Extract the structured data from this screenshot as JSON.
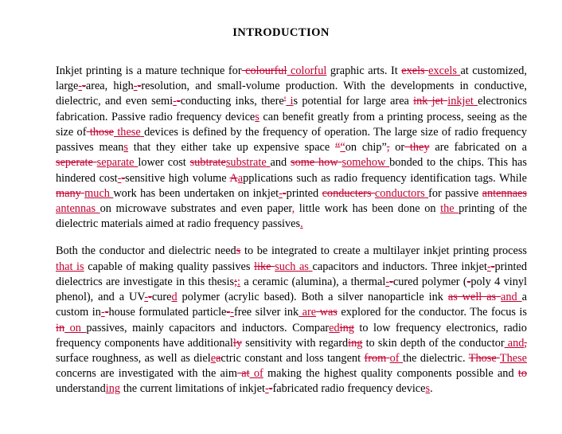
{
  "document": {
    "title": "INTRODUCTION",
    "revision_colors": {
      "insertion": "#c00030",
      "deletion": "#c00030",
      "normal_text": "#000000",
      "page_background": "#ffffff"
    },
    "paragraphs": [
      {
        "id": "paragraph-1",
        "plain_text": "Inkjet printing is a mature technique for colourful colorful graphic arts. It exels excels at customized, large-area, high-resolution, and small-volume production. With the developments in conductive, dielectric, and even semi-conducting inks, there' is potential for large area ink jet inkjet electronics fabrication. Passive radio frequency devices can benefit greatly from a printing process, seeing as the size of those these devices is defined by the frequency of operation. The large size of radio frequency passives means that they either take up expensive space \"on chip\", or they are fabricated on a seperate separate lower cost subtrate substrate and some how somehow bonded to the chips. This has hindered cost-sensitive high volume Aapplications such as radio frequency identification tags. While many much work has been undertaken on inkjet-printed conducters conductors for passive antennaes antennas on microwave substrates and even paper, little work has been done on the printing of the dielectric materials aimed at radio frequency passives.",
        "runs": [
          {
            "t": "Inkjet printing is a mature technique for",
            "k": "n"
          },
          {
            "t": " colourful",
            "k": "d"
          },
          {
            "t": " colorful",
            "k": "i"
          },
          {
            "t": " graphic arts. It ",
            "k": "n"
          },
          {
            "t": "exels",
            "k": "d"
          },
          {
            "t": " ",
            "k": "d"
          },
          {
            "t": " excels",
            "k": "i"
          },
          {
            "t": " ",
            "k": "i"
          },
          {
            "t": "at customized, large",
            "k": "n"
          },
          {
            "t": "-",
            "k": "i"
          },
          {
            "t": "-",
            "k": "d"
          },
          {
            "t": "area, high",
            "k": "n"
          },
          {
            "t": "-",
            "k": "i"
          },
          {
            "t": "-",
            "k": "d"
          },
          {
            "t": "resolution, and small-volume production. With the developments in conductive, dielectric, and even semi",
            "k": "n"
          },
          {
            "t": "-",
            "k": "i"
          },
          {
            "t": "-",
            "k": "d"
          },
          {
            "t": "conducting inks, there",
            "k": "n"
          },
          {
            "t": "'",
            "k": "d"
          },
          {
            "t": " i",
            "k": "i"
          },
          {
            "t": "s potential for large area ",
            "k": "n"
          },
          {
            "t": "ink jet",
            "k": "d"
          },
          {
            "t": " ",
            "k": "d"
          },
          {
            "t": " inkjet",
            "k": "i"
          },
          {
            "t": " ",
            "k": "i"
          },
          {
            "t": "electronics fabrication. Passive radio frequency device",
            "k": "n"
          },
          {
            "t": "s",
            "k": "i"
          },
          {
            "t": " can benefit greatly from a printing process, seeing as the size of",
            "k": "n"
          },
          {
            "t": " those",
            "k": "d"
          },
          {
            "t": " these",
            "k": "i"
          },
          {
            "t": " ",
            "k": "i"
          },
          {
            "t": "devices is defined by the frequency of operation. The large size of radio frequency passives mean",
            "k": "n"
          },
          {
            "t": "s",
            "k": "i"
          },
          {
            "t": " that they either take up expensive space ",
            "k": "n"
          },
          {
            "t": "“",
            "k": "d"
          },
          {
            "t": "“",
            "k": "i"
          },
          {
            "t": "on chip”",
            "k": "n"
          },
          {
            "t": ",",
            "k": "d"
          },
          {
            "t": " or",
            "k": "n"
          },
          {
            "t": " they",
            "k": "d"
          },
          {
            "t": " are fabricated on a ",
            "k": "n"
          },
          {
            "t": "seperate",
            "k": "d"
          },
          {
            "t": " ",
            "k": "d"
          },
          {
            "t": "separate",
            "k": "i"
          },
          {
            "t": " ",
            "k": "i"
          },
          {
            "t": "lower cost ",
            "k": "n"
          },
          {
            "t": "subtrate",
            "k": "d"
          },
          {
            "t": "substrate",
            "k": "i"
          },
          {
            "t": " ",
            "k": "i"
          },
          {
            "t": "and ",
            "k": "n"
          },
          {
            "t": "some how",
            "k": "d"
          },
          {
            "t": " ",
            "k": "d"
          },
          {
            "t": "somehow",
            "k": "i"
          },
          {
            "t": " ",
            "k": "i"
          },
          {
            "t": "bonded to the chips. This has hindered cost",
            "k": "n"
          },
          {
            "t": "-",
            "k": "i"
          },
          {
            "t": "-",
            "k": "d"
          },
          {
            "t": "sensitive high volume ",
            "k": "n"
          },
          {
            "t": "A",
            "k": "d"
          },
          {
            "t": "a",
            "k": "i"
          },
          {
            "t": "pplications such as radio frequency identification tags. While ",
            "k": "n"
          },
          {
            "t": "many",
            "k": "d"
          },
          {
            "t": " ",
            "k": "d"
          },
          {
            "t": "much",
            "k": "i"
          },
          {
            "t": " ",
            "k": "i"
          },
          {
            "t": "work has been undertaken on inkjet",
            "k": "n"
          },
          {
            "t": "-",
            "k": "i"
          },
          {
            "t": "-",
            "k": "d"
          },
          {
            "t": "printed ",
            "k": "n"
          },
          {
            "t": "conducters",
            "k": "d"
          },
          {
            "t": " ",
            "k": "d"
          },
          {
            "t": "conductors",
            "k": "i"
          },
          {
            "t": " ",
            "k": "i"
          },
          {
            "t": "for passive ",
            "k": "n"
          },
          {
            "t": "antennaes",
            "k": "d"
          },
          {
            "t": " ",
            "k": "d"
          },
          {
            "t": "antennas",
            "k": "i"
          },
          {
            "t": " ",
            "k": "i"
          },
          {
            "t": "on microwave substrates and even paper",
            "k": "n"
          },
          {
            "t": ",",
            "k": "i"
          },
          {
            "t": " little work has been done on ",
            "k": "n"
          },
          {
            "t": "the",
            "k": "i"
          },
          {
            "t": " ",
            "k": "i"
          },
          {
            "t": "printing of the dielectric materials aimed at radio frequency passives",
            "k": "n"
          },
          {
            "t": ".",
            "k": "i"
          }
        ]
      },
      {
        "id": "paragraph-2",
        "plain_text": "Both the conductor and dielectric needs to be integrated to create a multilayer inkjet printing process that is capable of making quality passives like such as capacitors and inductors. Three inkjet-printed dielectrics are investigate in this thesis;: a ceramic (alumina), a thermal-cured polymer (-poly 4 vinyl phenol), and a UV--cured polymer (acrylic based). Both a silver nanoparticle ink as well as and a custom in-house formulated particle-free silver ink are was explored for the conductor. The focus is in on passives, mainly capacitors and inductors. Compareding to low frequency electronics, radio frequency components have additionally sensitivity with regarding to skin depth of the conductor and, surface roughness, as well as dieleactric constant and loss tangent from of the dielectric. Those These concerns are investigated with the aim at of making the highest quality components possible and to understanding the current limitations of inkjet-fabricated radio frequency devices.",
        "runs": [
          {
            "t": "Both the conductor and dielectric need",
            "k": "n"
          },
          {
            "t": "s",
            "k": "d"
          },
          {
            "t": " to be integrated to create a multilayer inkjet printing process",
            "k": "n"
          },
          {
            "t": " that is",
            "k": "i"
          },
          {
            "t": " capable of making quality passives ",
            "k": "n"
          },
          {
            "t": "like",
            "k": "d"
          },
          {
            "t": " ",
            "k": "d"
          },
          {
            "t": "such as",
            "k": "i"
          },
          {
            "t": " ",
            "k": "i"
          },
          {
            "t": "capacitors and inductors. Three inkjet",
            "k": "n"
          },
          {
            "t": "-",
            "k": "i"
          },
          {
            "t": "-",
            "k": "d"
          },
          {
            "t": "printed dielectrics are investigate in this thesis",
            "k": "n"
          },
          {
            "t": ";",
            "k": "d"
          },
          {
            "t": ":",
            "k": "i"
          },
          {
            "t": " a ceramic (alumina), a thermal",
            "k": "n"
          },
          {
            "t": "-",
            "k": "i"
          },
          {
            "t": "-",
            "k": "d"
          },
          {
            "t": "cured polymer (",
            "k": "n"
          },
          {
            "t": "-",
            "k": "d"
          },
          {
            "t": "poly 4 vinyl phenol), and a UV",
            "k": "n"
          },
          {
            "t": "-",
            "k": "i"
          },
          {
            "t": "-",
            "k": "d"
          },
          {
            "t": "cure",
            "k": "n"
          },
          {
            "t": "d",
            "k": "i"
          },
          {
            "t": " polymer (acrylic based). Both a silver nanoparticle ink ",
            "k": "n"
          },
          {
            "t": "as well as",
            "k": "d"
          },
          {
            "t": " ",
            "k": "d"
          },
          {
            "t": "and",
            "k": "i"
          },
          {
            "t": " ",
            "k": "i"
          },
          {
            "t": "a custom in",
            "k": "n"
          },
          {
            "t": "-",
            "k": "i"
          },
          {
            "t": "-",
            "k": "d"
          },
          {
            "t": "house formulated particle",
            "k": "n"
          },
          {
            "t": "-",
            "k": "d"
          },
          {
            "t": "-",
            "k": "i"
          },
          {
            "t": "free silver ink",
            "k": "n"
          },
          {
            "t": " are",
            "k": "i"
          },
          {
            "t": " was",
            "k": "d"
          },
          {
            "t": " explored for the conductor. The focus is ",
            "k": "n"
          },
          {
            "t": "in",
            "k": "d"
          },
          {
            "t": " on",
            "k": "i"
          },
          {
            "t": " ",
            "k": "i"
          },
          {
            "t": "passives, mainly capacitors and inductors. Compar",
            "k": "n"
          },
          {
            "t": "ed",
            "k": "i"
          },
          {
            "t": "ing",
            "k": "d"
          },
          {
            "t": " to low frequency electronics, radio frequency components have additional",
            "k": "n"
          },
          {
            "t": "ly",
            "k": "d"
          },
          {
            "t": " sensitivity with regard",
            "k": "n"
          },
          {
            "t": "ing",
            "k": "d"
          },
          {
            "t": " to skin depth of the conductor",
            "k": "n"
          },
          {
            "t": " and",
            "k": "i"
          },
          {
            "t": ",",
            "k": "d"
          },
          {
            "t": " surface roughness, as well as diel",
            "k": "n"
          },
          {
            "t": "e",
            "k": "i"
          },
          {
            "t": "a",
            "k": "d"
          },
          {
            "t": "ctric constant and loss tangent ",
            "k": "n"
          },
          {
            "t": "from",
            "k": "d"
          },
          {
            "t": " ",
            "k": "d"
          },
          {
            "t": "of",
            "k": "i"
          },
          {
            "t": " ",
            "k": "i"
          },
          {
            "t": "the dielectric. ",
            "k": "n"
          },
          {
            "t": "Those",
            "k": "d"
          },
          {
            "t": " ",
            "k": "d"
          },
          {
            "t": "These",
            "k": "i"
          },
          {
            "t": " ",
            "k": "i"
          },
          {
            "t": "concerns are investigated with the aim",
            "k": "n"
          },
          {
            "t": " at",
            "k": "d"
          },
          {
            "t": " of",
            "k": "i"
          },
          {
            "t": " making the highest quality components possible and ",
            "k": "n"
          },
          {
            "t": "to",
            "k": "d"
          },
          {
            "t": " understand",
            "k": "n"
          },
          {
            "t": "ing",
            "k": "i"
          },
          {
            "t": " the current limitations of inkjet",
            "k": "n"
          },
          {
            "t": "-",
            "k": "i"
          },
          {
            "t": "-",
            "k": "d"
          },
          {
            "t": "fabricated radio frequency device",
            "k": "n"
          },
          {
            "t": "s",
            "k": "i"
          },
          {
            "t": ".",
            "k": "n"
          }
        ]
      }
    ]
  }
}
